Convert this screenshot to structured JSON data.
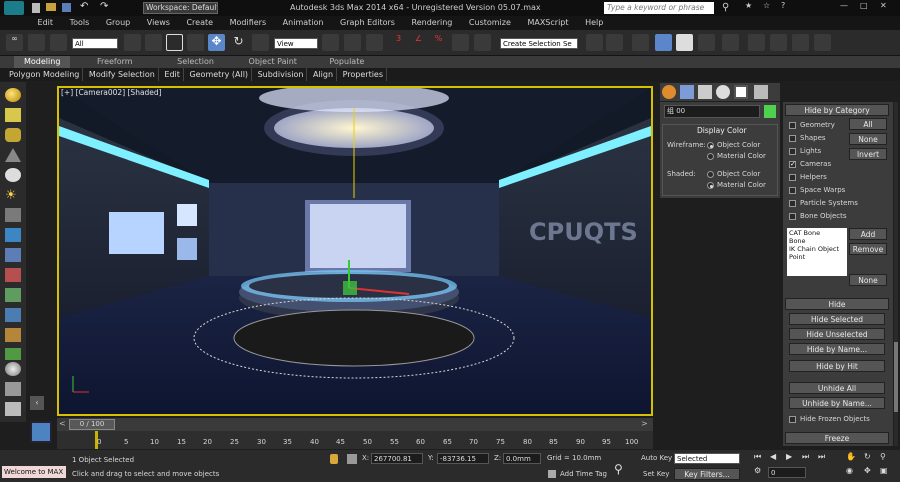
{
  "title_bar": {
    "workspace": "Workspace: Default",
    "title": "Autodesk 3ds Max 2014 x64 - Unregistered Version 05.07.max",
    "search_placeholder": "Type a keyword or phrase"
  },
  "menu": [
    "Edit",
    "Tools",
    "Group",
    "Views",
    "Create",
    "Modifiers",
    "Animation",
    "Graph Editors",
    "Rendering",
    "Customize",
    "MAXScript",
    "Help"
  ],
  "toolbar": {
    "filter": "All",
    "ref_coord": "View",
    "selection_set": "Create Selection Se"
  },
  "ribbon": {
    "tabs": [
      "Modeling",
      "Freeform",
      "Selection",
      "Object Paint",
      "Populate"
    ],
    "sub": [
      "Polygon Modeling",
      "Modify Selection",
      "Edit",
      "Geometry (All)",
      "Subdivision",
      "Align",
      "Properties"
    ]
  },
  "viewport": {
    "label": "[+] [Camera002] [Shaded]",
    "sign": "CPUQTS"
  },
  "cmd_panel": {
    "name_field": "组 00",
    "display_color": "Display Color",
    "wireframe": "Wireframe:",
    "shaded": "Shaded:",
    "object_color": "Object Color",
    "material_color": "Material Color",
    "color_swatch": "#4fd14f"
  },
  "hide_by_category": {
    "header": "Hide by Category",
    "items": [
      {
        "label": "Geometry",
        "checked": false
      },
      {
        "label": "Shapes",
        "checked": false
      },
      {
        "label": "Lights",
        "checked": false
      },
      {
        "label": "Cameras",
        "checked": true
      },
      {
        "label": "Helpers",
        "checked": false
      },
      {
        "label": "Space Warps",
        "checked": false
      },
      {
        "label": "Particle Systems",
        "checked": false
      },
      {
        "label": "Bone Objects",
        "checked": false
      }
    ],
    "all": "All",
    "none": "None",
    "invert": "Invert",
    "list": [
      "CAT Bone",
      "Bone",
      "IK Chain Object",
      "Point"
    ],
    "add": "Add",
    "remove": "Remove",
    "none2": "None"
  },
  "hide": {
    "header": "Hide",
    "buttons": [
      "Hide Selected",
      "Hide Unselected",
      "Hide by Name...",
      "Hide by Hit",
      "Unhide All",
      "Unhide by Name..."
    ],
    "frozen": "Hide Frozen Objects",
    "freeze_header": "Freeze"
  },
  "timeline": {
    "slider": "0 / 100",
    "ticks": [
      "0",
      "5",
      "10",
      "15",
      "20",
      "25",
      "30",
      "35",
      "40",
      "45",
      "50",
      "55",
      "60",
      "65",
      "70",
      "75",
      "80",
      "85",
      "90",
      "95",
      "100"
    ]
  },
  "status": {
    "maxscript": "Welcome to MAX",
    "selected": "1 Object Selected",
    "prompt": "Click and drag to select and move objects",
    "x_label": "X:",
    "x": "267700.81",
    "y_label": "Y:",
    "y": "-83736.15",
    "z_label": "Z:",
    "z": "0.0mm",
    "grid": "Grid = 10.0mm",
    "add_time_tag": "Add Time Tag",
    "auto_key": "Auto Key",
    "selected_dd": "Selected",
    "set_key": "Set Key",
    "key_filters": "Key Filters...",
    "frame": "0"
  }
}
